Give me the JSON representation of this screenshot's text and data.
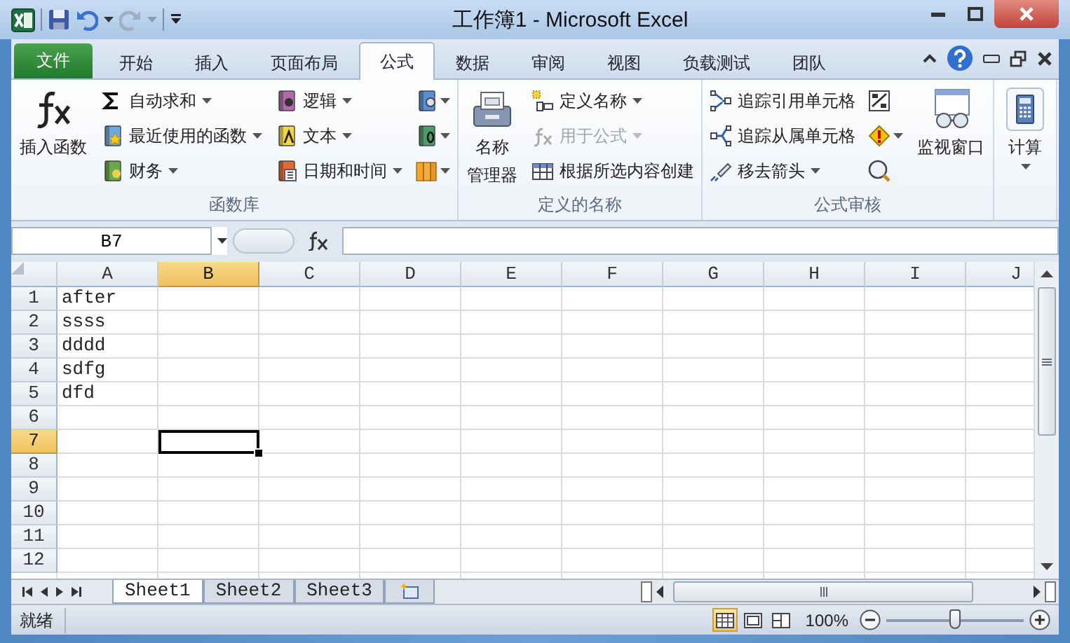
{
  "window": {
    "title": "工作簿1 - Microsoft Excel"
  },
  "tabs": [
    {
      "label": "文件",
      "kind": "file",
      "selected": false
    },
    {
      "label": "开始",
      "kind": "tab",
      "selected": false
    },
    {
      "label": "插入",
      "kind": "tab",
      "selected": false
    },
    {
      "label": "页面布局",
      "kind": "tab",
      "selected": false
    },
    {
      "label": "公式",
      "kind": "tab",
      "selected": true
    },
    {
      "label": "数据",
      "kind": "tab",
      "selected": false
    },
    {
      "label": "审阅",
      "kind": "tab",
      "selected": false
    },
    {
      "label": "视图",
      "kind": "tab",
      "selected": false
    },
    {
      "label": "负载测试",
      "kind": "tab",
      "selected": false
    },
    {
      "label": "团队",
      "kind": "tab",
      "selected": false
    }
  ],
  "ribbon": {
    "groups": [
      {
        "label": "函数库",
        "columns": [
          [
            {
              "kind": "large",
              "lines": [
                "插入函数"
              ],
              "dropdown": false,
              "disabled": false
            }
          ],
          [
            {
              "kind": "small",
              "label": "自动求和",
              "dropdown": true,
              "disabled": false
            },
            {
              "kind": "small",
              "label": "最近使用的函数",
              "dropdown": true,
              "disabled": false
            },
            {
              "kind": "small",
              "label": "财务",
              "dropdown": true,
              "disabled": false
            }
          ],
          [
            {
              "kind": "small",
              "label": "逻辑",
              "dropdown": true,
              "disabled": false
            },
            {
              "kind": "small",
              "label": "文本",
              "dropdown": true,
              "disabled": false
            },
            {
              "kind": "small",
              "label": "日期和时间",
              "dropdown": true,
              "disabled": false
            }
          ],
          [
            {
              "kind": "icon",
              "dropdown": true,
              "disabled": false
            },
            {
              "kind": "icon",
              "dropdown": true,
              "disabled": false
            },
            {
              "kind": "icon",
              "dropdown": true,
              "disabled": false
            }
          ]
        ]
      },
      {
        "label": "定义的名称",
        "columns": [
          [
            {
              "kind": "large",
              "lines": [
                "名称",
                "管理器"
              ],
              "dropdown": false,
              "disabled": false
            }
          ],
          [
            {
              "kind": "small",
              "label": "定义名称",
              "dropdown": true,
              "disabled": false
            },
            {
              "kind": "small",
              "label": "用于公式",
              "dropdown": true,
              "disabled": true
            },
            {
              "kind": "small",
              "label": "根据所选内容创建",
              "dropdown": false,
              "disabled": false
            }
          ]
        ]
      },
      {
        "label": "公式审核",
        "columns": [
          [
            {
              "kind": "small",
              "label": "追踪引用单元格",
              "dropdown": false,
              "disabled": false
            },
            {
              "kind": "small",
              "label": "追踪从属单元格",
              "dropdown": false,
              "disabled": false
            },
            {
              "kind": "small",
              "label": "移去箭头",
              "dropdown": true,
              "disabled": false
            }
          ],
          [
            {
              "kind": "icon",
              "dropdown": false,
              "disabled": false
            },
            {
              "kind": "icon",
              "dropdown": true,
              "disabled": false
            },
            {
              "kind": "icon",
              "dropdown": false,
              "disabled": false
            }
          ],
          [
            {
              "kind": "large",
              "lines": [
                "监视窗口"
              ],
              "dropdown": false,
              "disabled": false
            }
          ]
        ]
      },
      {
        "columns": [
          [
            {
              "kind": "large",
              "lines": [
                "计算"
              ],
              "dropdown": true,
              "disabled": false
            }
          ]
        ]
      }
    ]
  },
  "formula_bar": {
    "name_box": "B7"
  },
  "grid": {
    "columns": [
      {
        "label": "A",
        "selected": false
      },
      {
        "label": "B",
        "selected": true
      },
      {
        "label": "C",
        "selected": false
      },
      {
        "label": "D",
        "selected": false
      },
      {
        "label": "E",
        "selected": false
      },
      {
        "label": "F",
        "selected": false
      },
      {
        "label": "G",
        "selected": false
      },
      {
        "label": "H",
        "selected": false
      },
      {
        "label": "I",
        "selected": false
      },
      {
        "label": "J",
        "selected": false
      }
    ],
    "rows": [
      {
        "label": "1",
        "selected": false,
        "cells": [
          "after"
        ]
      },
      {
        "label": "2",
        "selected": false,
        "cells": [
          "ssss"
        ]
      },
      {
        "label": "3",
        "selected": false,
        "cells": [
          "dddd"
        ]
      },
      {
        "label": "4",
        "selected": false,
        "cells": [
          "sdfg"
        ]
      },
      {
        "label": "5",
        "selected": false,
        "cells": [
          "dfd"
        ]
      },
      {
        "label": "6",
        "selected": false
      },
      {
        "label": "7",
        "selected": true
      },
      {
        "label": "8",
        "selected": false
      },
      {
        "label": "9",
        "selected": false
      },
      {
        "label": "10",
        "selected": false
      },
      {
        "label": "11",
        "selected": false
      },
      {
        "label": "12",
        "selected": false
      }
    ]
  },
  "sheets": [
    {
      "label": "Sheet1",
      "selected": true
    },
    {
      "label": "Sheet2",
      "selected": false
    },
    {
      "label": "Sheet3",
      "selected": false
    }
  ],
  "status_bar": {
    "text": "就绪",
    "views": [
      {
        "selected": true
      },
      {
        "selected": false
      },
      {
        "selected": false
      }
    ],
    "zoom": "100%",
    "zoom_slider": {
      "level": 0.5
    }
  }
}
